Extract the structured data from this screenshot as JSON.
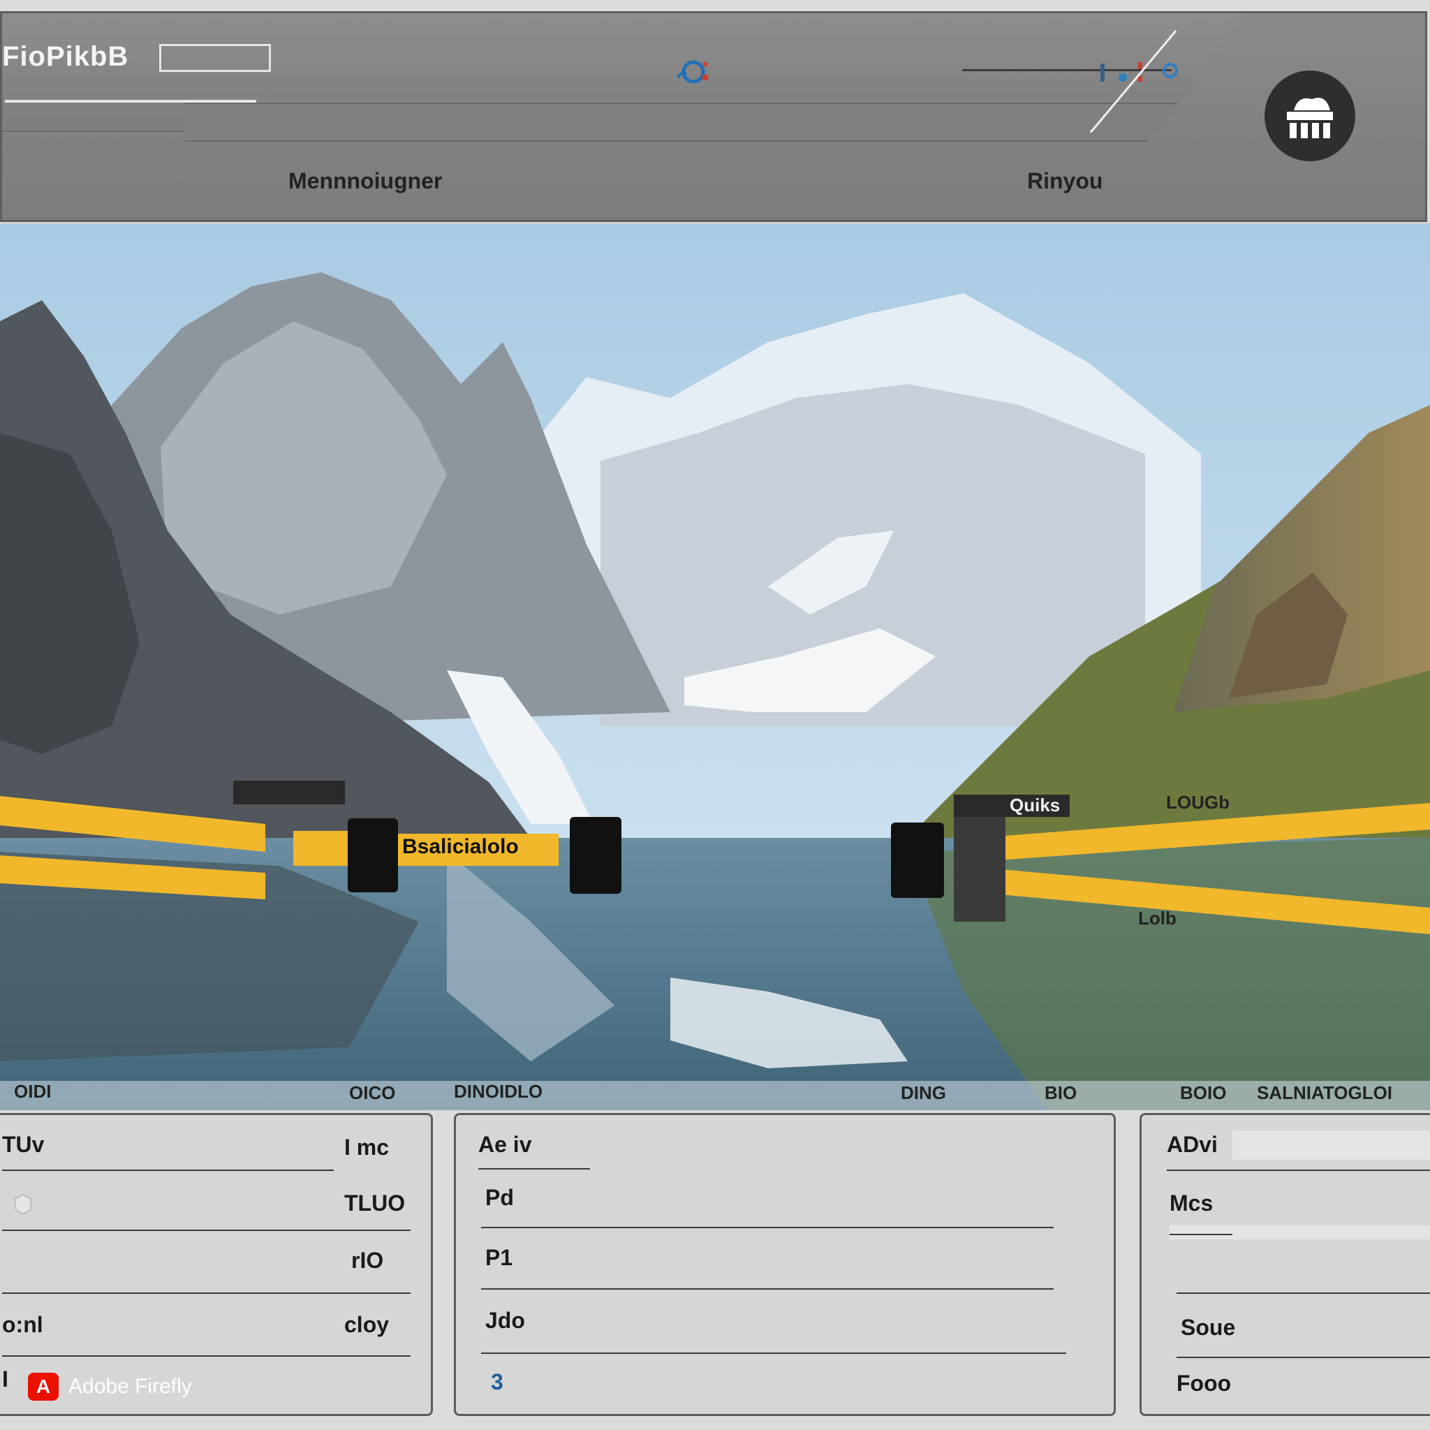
{
  "header": {
    "app_title": "FioPikbB",
    "nav": {
      "left": "Mennnoiugner",
      "right": "Rinyou"
    }
  },
  "hero": {
    "tape_label": "Bsalicialolo",
    "right_tag_top": "Quiks",
    "right_tag": "LOUGb",
    "right_tag_low": "Lolb",
    "bottom_strip": [
      "OIDI",
      "OICO",
      "DINOIDLO",
      "DING",
      "BIO",
      "BOIO",
      "SALNIATOGLOI"
    ]
  },
  "panels": {
    "left": {
      "header_left": "TUv",
      "rows": [
        {
          "label": "",
          "value": "I mc"
        },
        {
          "label": "",
          "value": "TLUO"
        },
        {
          "label": "",
          "value": "rIO"
        },
        {
          "label": "o:nl",
          "value": "cloy"
        },
        {
          "label": "I",
          "value": ""
        }
      ]
    },
    "middle": {
      "header": "Ae iv",
      "rows": [
        "Pd",
        "P1",
        "Jdo",
        "3"
      ]
    },
    "right": {
      "header": "ADvi",
      "rows": [
        "Mcs",
        "Soue",
        "Fooo"
      ]
    }
  },
  "watermark": {
    "text": "Adobe Firefly",
    "logo": "A"
  },
  "colors": {
    "tape": "#f0b82a",
    "header_bg": "#848484",
    "panel_bg": "#d6d6d6"
  }
}
